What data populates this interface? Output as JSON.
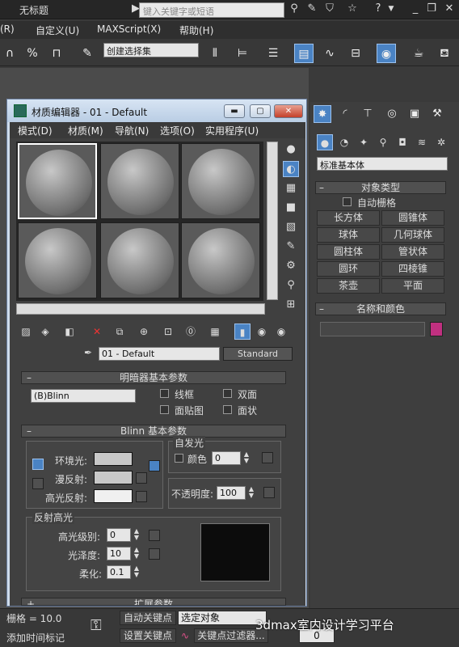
{
  "app": {
    "title": "无标题",
    "search_placeholder": "键入关键字或短语"
  },
  "menubar": [
    "(R)",
    "自定义(U)",
    "MAXScript(X)",
    "帮助(H)"
  ],
  "toolbar": {
    "selection_set": "创建选择集"
  },
  "material_editor": {
    "title": "材质编辑器 - 01 - Default",
    "menus": [
      "模式(D)",
      "材质(M)",
      "导航(N)",
      "选项(O)",
      "实用程序(U)"
    ],
    "material_name": "01 - Default",
    "material_type": "Standard",
    "rollout_shader": "明暗器基本参数",
    "shader_type": "(B)Blinn",
    "opt_wire": "线框",
    "opt_2sided": "双面",
    "opt_facemap": "面贴图",
    "opt_faceted": "面状",
    "rollout_blinn": "Blinn 基本参数",
    "ambient": "环境光:",
    "diffuse": "漫反射:",
    "specular": "高光反射:",
    "self_illum": "自发光",
    "color_label": "颜色",
    "color_value": "0",
    "opacity_label": "不透明度:",
    "opacity_value": "100",
    "specular_group": "反射高光",
    "spec_level": "高光级别:",
    "spec_level_value": "0",
    "gloss": "光泽度:",
    "gloss_value": "10",
    "soften": "柔化:",
    "soften_value": "0.1",
    "rollout_ext": "扩展参数"
  },
  "command_panel": {
    "category": "标准基本体",
    "rollout_object_type": "对象类型",
    "autogrid": "自动栅格",
    "objects": [
      "长方体",
      "圆锥体",
      "球体",
      "几何球体",
      "圆柱体",
      "管状体",
      "圆环",
      "四棱锥",
      "茶壶",
      "平面"
    ],
    "rollout_name_color": "名称和颜色",
    "object_color": "#c03080"
  },
  "status": {
    "grid": "栅格 = 10.0",
    "add_time_tag": "添加时间标记",
    "auto_key": "自动关键点",
    "selection": "选定对象",
    "set_key": "设置关键点",
    "key_filter": "关键点过滤器...",
    "frame": "0"
  },
  "watermark": "3dmax室内设计学习平台"
}
